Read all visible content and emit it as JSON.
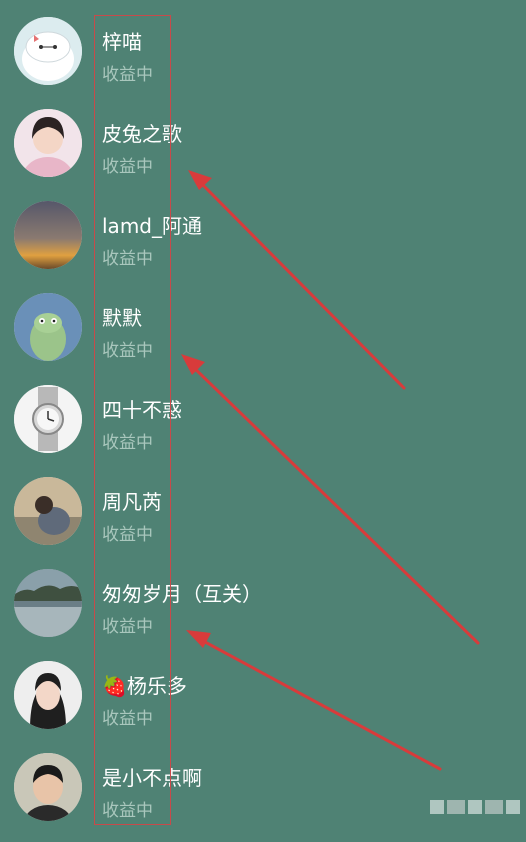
{
  "contacts": [
    {
      "name": "梓喵",
      "status": "收益中"
    },
    {
      "name": "皮兔之歌",
      "status": "收益中"
    },
    {
      "name": "lamd_阿通",
      "status": "收益中"
    },
    {
      "name": "默默",
      "status": "收益中"
    },
    {
      "name": "四十不惑",
      "status": "收益中"
    },
    {
      "name": "周凡芮",
      "status": "收益中"
    },
    {
      "name": "匆匆岁月（互关）",
      "status": "收益中"
    },
    {
      "name": "杨乐多",
      "status": "收益中"
    },
    {
      "name": "是小不点啊",
      "status": "收益中"
    }
  ],
  "emoji": "🍓",
  "colors": {
    "background": "#4f8274",
    "annotation_red": "#d83b3b",
    "status_text": "#a9c7bd"
  }
}
